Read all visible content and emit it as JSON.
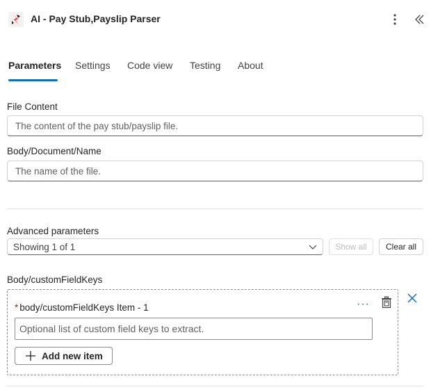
{
  "header": {
    "title": "AI - Pay Stub,Payslip Parser",
    "logo_icon": "ai-builder-logo-icon",
    "menu_icon": "more-vertical-icon",
    "collapse_icon": "double-chevron-left-icon"
  },
  "tabs": [
    {
      "label": "Parameters",
      "active": true
    },
    {
      "label": "Settings",
      "active": false
    },
    {
      "label": "Code view",
      "active": false
    },
    {
      "label": "Testing",
      "active": false
    },
    {
      "label": "About",
      "active": false
    }
  ],
  "fields": {
    "file_content": {
      "label": "File Content",
      "placeholder": "The content of the pay stub/payslip file."
    },
    "document_name": {
      "label": "Body/Document/Name",
      "placeholder": "The name of the file."
    }
  },
  "advanced": {
    "label": "Advanced parameters",
    "selected": "Showing 1 of 1",
    "show_all": "Show all",
    "clear_all": "Clear all"
  },
  "custom_keys": {
    "label": "Body/customFieldKeys",
    "item_label": "body/customFieldKeys Item - 1",
    "required_mark": "*",
    "ellipsis": "···",
    "item_placeholder": "Optional list of custom field keys to extract.",
    "add_item": "Add new item"
  },
  "colors": {
    "accent": "#0f6cbd",
    "required": "#c50f1f",
    "logo_red": "#e8262b"
  }
}
